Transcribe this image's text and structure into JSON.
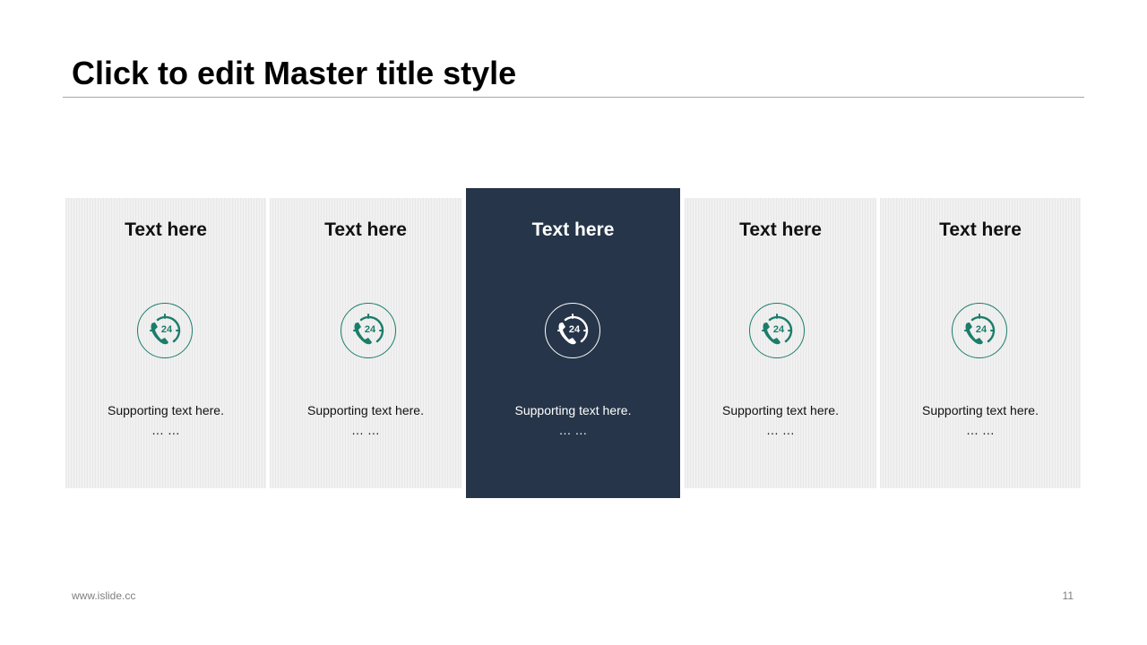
{
  "slide": {
    "title": "Click to edit Master title style",
    "footer_url": "www.islide.cc",
    "page_number": "11"
  },
  "cards": [
    {
      "heading": "Text here",
      "support": "Supporting text here.",
      "ellipsis": "… …",
      "icon": "phone-24h-icon",
      "active": false
    },
    {
      "heading": "Text here",
      "support": "Supporting text here.",
      "ellipsis": "… …",
      "icon": "phone-24h-icon",
      "active": false
    },
    {
      "heading": "Text here",
      "support": "Supporting text here.",
      "ellipsis": "… …",
      "icon": "phone-24h-icon",
      "active": true
    },
    {
      "heading": "Text here",
      "support": "Supporting text here.",
      "ellipsis": "… …",
      "icon": "phone-24h-icon",
      "active": false
    },
    {
      "heading": "Text here",
      "support": "Supporting text here.",
      "ellipsis": "… …",
      "icon": "phone-24h-icon",
      "active": false
    }
  ],
  "colors": {
    "accent": "#1b7d6a",
    "active_card": "#263549",
    "card_bg": "#f1f1f1"
  }
}
